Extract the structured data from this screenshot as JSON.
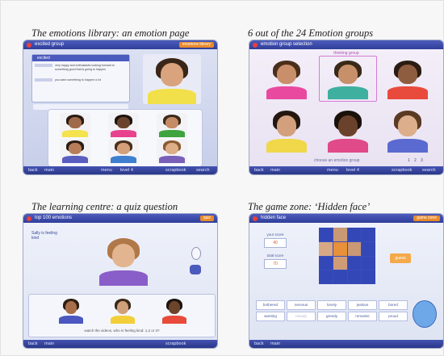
{
  "captions": {
    "p1": "The emotions library: an emotion page",
    "p2": "6 out of the 24 Emotion groups",
    "p3": "The learning centre: a quiz question",
    "p4": "The game zone: ‘Hidden face’"
  },
  "panel1": {
    "title": "excited group",
    "right_tab": "emotions library",
    "emotion_title": "excited",
    "description": "very happy and enthusiastic looking forward to something good that is going to happen",
    "example": "you want something to happen a lot",
    "footer": {
      "back": "back",
      "main": "main",
      "menu": "menu",
      "level": "level 4",
      "scrapbook": "scrapbook",
      "search": "search"
    }
  },
  "panel2": {
    "title": "emotion group selection",
    "highlight_label": "thinking group",
    "prompt": "choose an emotion group",
    "pages": [
      "1",
      "2",
      "3"
    ],
    "footer": {
      "back": "back",
      "main": "main",
      "menu": "menu",
      "level": "level 4",
      "scrapbook": "scrapbook",
      "search": "search"
    }
  },
  "panel3": {
    "title": "top 100 emotions",
    "right_tab": "quiz",
    "question": "Sally is feeling kind",
    "instruction": "watch the videos, who is feeling kind: 1,2 or 3?",
    "footer": {
      "back": "back",
      "main": "main",
      "scrapbook": "scrapbook"
    }
  },
  "panel4": {
    "title": "hidden face",
    "right_tab": "game zone",
    "score_label": "your score",
    "score_value": "40",
    "total_label": "total score",
    "total_value": "70",
    "guess_button": "guess",
    "words": [
      "bothered",
      "nervous",
      "lonely",
      "jealous",
      "bored",
      "wanting",
      "moody",
      "greedy",
      "romantic",
      "proud"
    ],
    "footer": {
      "back": "back",
      "main": "main"
    }
  }
}
